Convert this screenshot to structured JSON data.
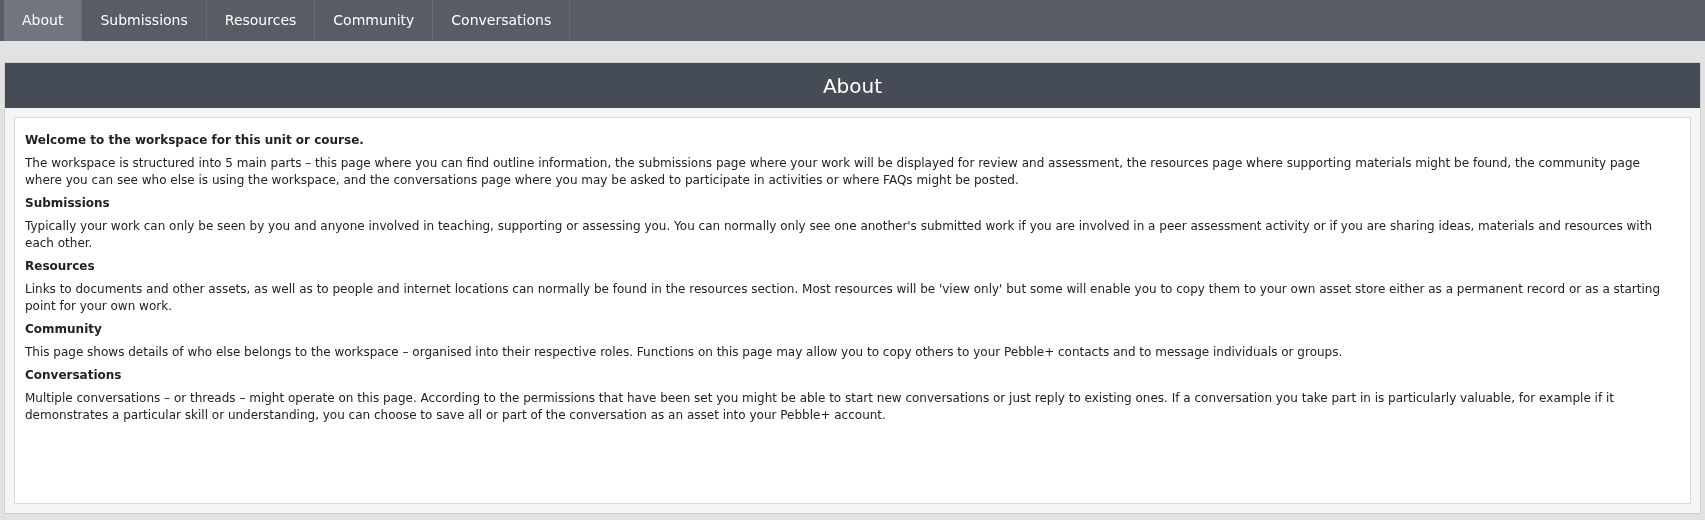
{
  "tabs": [
    {
      "label": "About",
      "selected": true
    },
    {
      "label": "Submissions",
      "selected": false
    },
    {
      "label": "Resources",
      "selected": false
    },
    {
      "label": "Community",
      "selected": false
    },
    {
      "label": "Conversations",
      "selected": false
    }
  ],
  "panel": {
    "title": "About",
    "sections": [
      {
        "heading": "Welcome to the workspace for this unit or course.",
        "body": "The workspace is structured into 5 main parts – this page where you can find outline information, the submissions page where your work will be displayed for review and assessment, the resources page where supporting materials might be found, the community page where you can see who else is using the workspace, and the conversations page where you may be asked to participate in activities or where FAQs might be posted."
      },
      {
        "heading": "Submissions",
        "body": "Typically your work can only be seen by you and anyone involved in teaching, supporting or assessing you. You can normally only see one another's submitted work if you are involved in a peer assessment activity or if you are sharing ideas, materials and resources with each other."
      },
      {
        "heading": "Resources",
        "body": "Links to documents and other assets, as well as to people and internet locations can normally be found in the resources section. Most resources will be 'view only' but some will enable you to copy them to your own asset store either as a permanent record or as a starting point for your own work."
      },
      {
        "heading": "Community",
        "body": "This page shows details of who else belongs to the workspace – organised into their respective roles. Functions on this page may allow you to copy others to your Pebble+ contacts and to message individuals or groups."
      },
      {
        "heading": "Conversations",
        "body": "Multiple conversations – or threads – might operate on this page. According to the permissions that have been set you might be able to start new conversations or just reply to existing ones. If a conversation you take part in is particularly valuable, for example if it demonstrates a particular skill or understanding, you can choose to save all or part of the conversation as an asset into your Pebble+ account."
      }
    ]
  }
}
